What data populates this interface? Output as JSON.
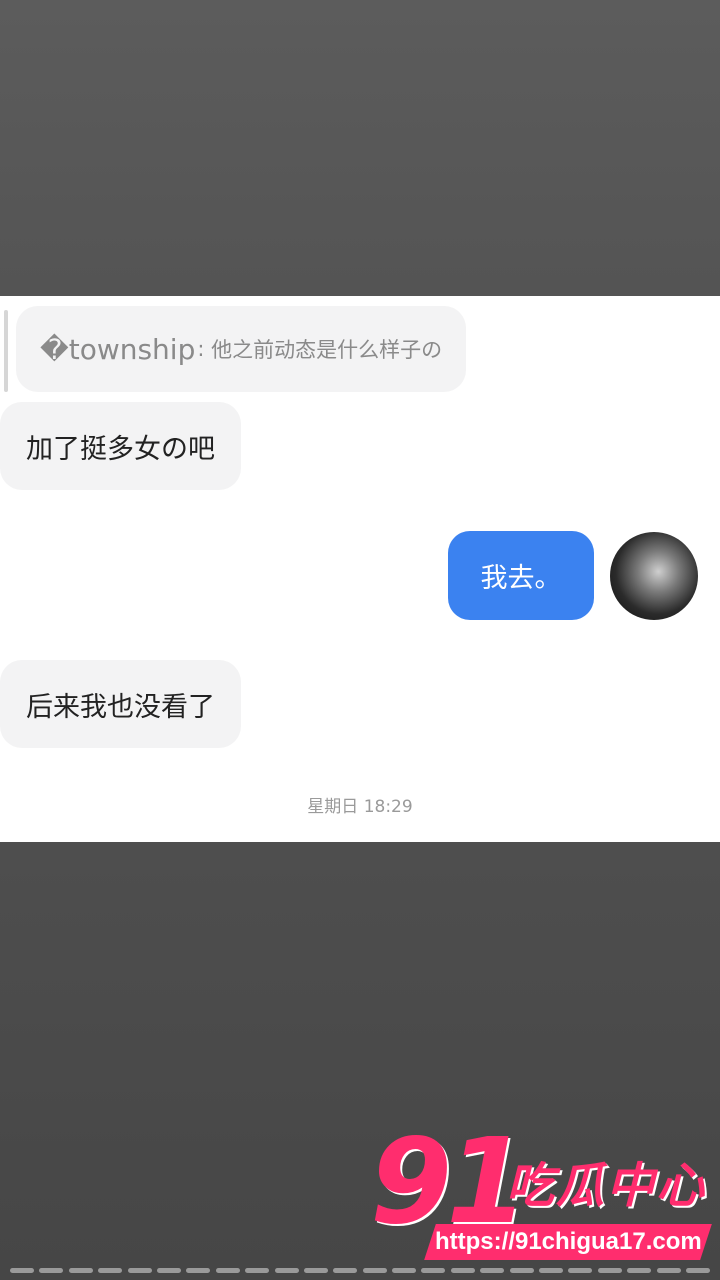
{
  "messages": {
    "quoted_sender": "�township",
    "quoted_text": "他之前动态是什么样子の",
    "m1": "加了挺多女の吧",
    "m2": "我去。",
    "m3": "后来我也没看了"
  },
  "timestamp": "星期日 18:29",
  "watermark": {
    "number": "91",
    "name": "吃瓜中心",
    "url": "https://91chigua17.com"
  }
}
